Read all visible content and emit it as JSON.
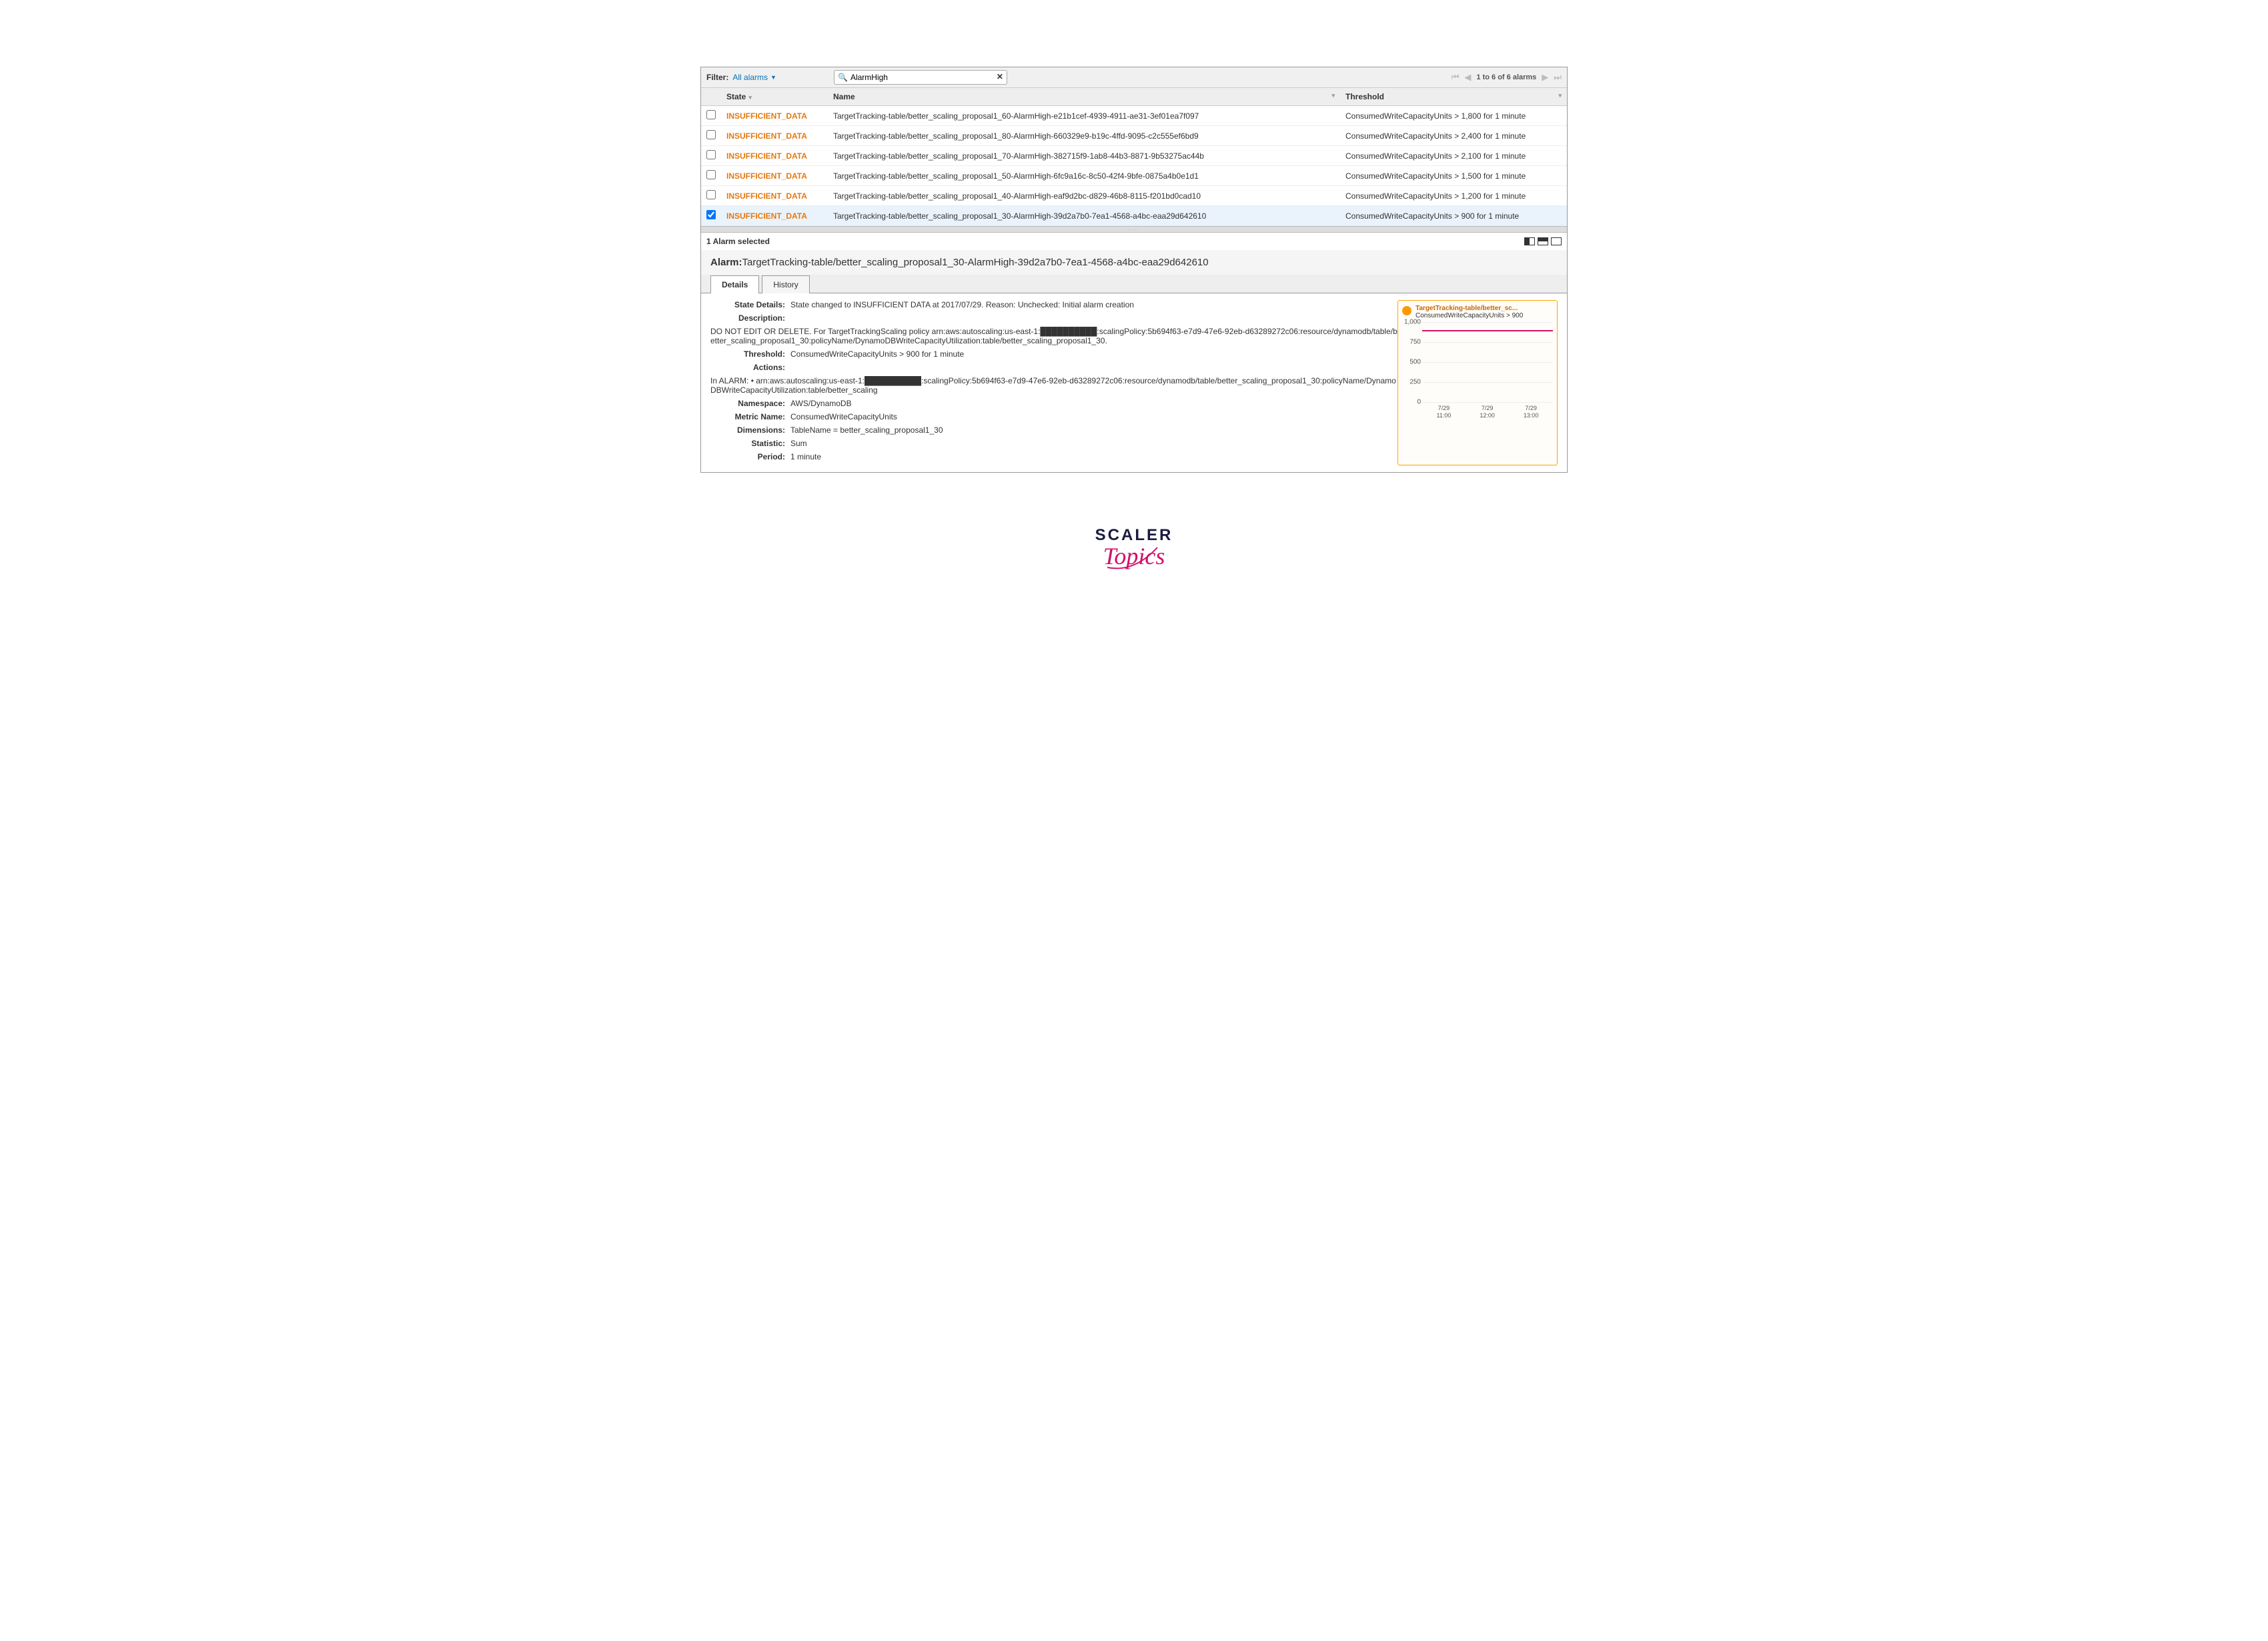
{
  "toolbar": {
    "filter_label": "Filter:",
    "filter_value": "All alarms",
    "search_value": "AlarmHigh",
    "pager_text": "1 to 6 of 6 alarms"
  },
  "columns": {
    "state": "State",
    "name": "Name",
    "threshold": "Threshold"
  },
  "rows": [
    {
      "checked": false,
      "state": "INSUFFICIENT_DATA",
      "name": "TargetTracking-table/better_scaling_proposal1_60-AlarmHigh-e21b1cef-4939-4911-ae31-3ef01ea7f097",
      "threshold": "ConsumedWriteCapacityUnits > 1,800 for 1 minute"
    },
    {
      "checked": false,
      "state": "INSUFFICIENT_DATA",
      "name": "TargetTracking-table/better_scaling_proposal1_80-AlarmHigh-660329e9-b19c-4ffd-9095-c2c555ef6bd9",
      "threshold": "ConsumedWriteCapacityUnits > 2,400 for 1 minute"
    },
    {
      "checked": false,
      "state": "INSUFFICIENT_DATA",
      "name": "TargetTracking-table/better_scaling_proposal1_70-AlarmHigh-382715f9-1ab8-44b3-8871-9b53275ac44b",
      "threshold": "ConsumedWriteCapacityUnits > 2,100 for 1 minute"
    },
    {
      "checked": false,
      "state": "INSUFFICIENT_DATA",
      "name": "TargetTracking-table/better_scaling_proposal1_50-AlarmHigh-6fc9a16c-8c50-42f4-9bfe-0875a4b0e1d1",
      "threshold": "ConsumedWriteCapacityUnits > 1,500 for 1 minute"
    },
    {
      "checked": false,
      "state": "INSUFFICIENT_DATA",
      "name": "TargetTracking-table/better_scaling_proposal1_40-AlarmHigh-eaf9d2bc-d829-46b8-8115-f201bd0cad10",
      "threshold": "ConsumedWriteCapacityUnits > 1,200 for 1 minute"
    },
    {
      "checked": true,
      "state": "INSUFFICIENT_DATA",
      "name": "TargetTracking-table/better_scaling_proposal1_30-AlarmHigh-39d2a7b0-7ea1-4568-a4bc-eaa29d642610",
      "threshold": "ConsumedWriteCapacityUnits > 900 for 1 minute"
    }
  ],
  "selection": {
    "count_text": "1 Alarm selected",
    "alarm_prefix": "Alarm:",
    "alarm_name": "TargetTracking-table/better_scaling_proposal1_30-AlarmHigh-39d2a7b0-7ea1-4568-a4bc-eaa29d642610"
  },
  "tabs": {
    "details": "Details",
    "history": "History"
  },
  "details": {
    "state_details_k": "State Details:",
    "state_details_v": "State changed to INSUFFICIENT DATA at 2017/07/29. Reason: Unchecked: Initial alarm creation",
    "description_k": "Description:",
    "description_v": "DO NOT EDIT OR DELETE. For TargetTrackingScaling policy arn:aws:autoscaling:us-east-1:██████████:scalingPolicy:5b694f63-e7d9-47e6-92eb-d63289272c06:resource/dynamodb/table/better_scaling_proposal1_30:policyName/DynamoDBWriteCapacityUtilization:table/better_scaling_proposal1_30.",
    "threshold_k": "Threshold:",
    "threshold_v": "ConsumedWriteCapacityUnits > 900 for 1 minute",
    "actions_k": "Actions:",
    "actions_prefix": "In ALARM:  •  ",
    "actions_v": "arn:aws:autoscaling:us-east-1:██████████:scalingPolicy:5b694f63-e7d9-47e6-92eb-d63289272c06:resource/dynamodb/table/better_scaling_proposal1_30:policyName/DynamoDBWriteCapacityUtilization:table/better_scaling",
    "namespace_k": "Namespace:",
    "namespace_v": "AWS/DynamoDB",
    "metric_name_k": "Metric Name:",
    "metric_name_v": "ConsumedWriteCapacityUnits",
    "dimensions_k": "Dimensions:",
    "dimensions_v": "TableName = better_scaling_proposal1_30",
    "statistic_k": "Statistic:",
    "statistic_v": "Sum",
    "period_k": "Period:",
    "period_v": "1 minute"
  },
  "chart_data": {
    "type": "line",
    "title": "TargetTracking-table/better_sc...",
    "subtitle": "ConsumedWriteCapacityUnits > 900",
    "ylim": [
      0,
      1000
    ],
    "yticks": [
      0,
      250,
      500,
      750,
      1000
    ],
    "threshold_value": 900,
    "x_ticks": [
      "7/29\n11:00",
      "7/29\n12:00",
      "7/29\n13:00"
    ],
    "series": [
      {
        "name": "threshold",
        "values": [
          900,
          900,
          900
        ],
        "color": "#d0126a"
      }
    ]
  },
  "logo": {
    "top": "SCALER",
    "bottom": "Topics"
  }
}
